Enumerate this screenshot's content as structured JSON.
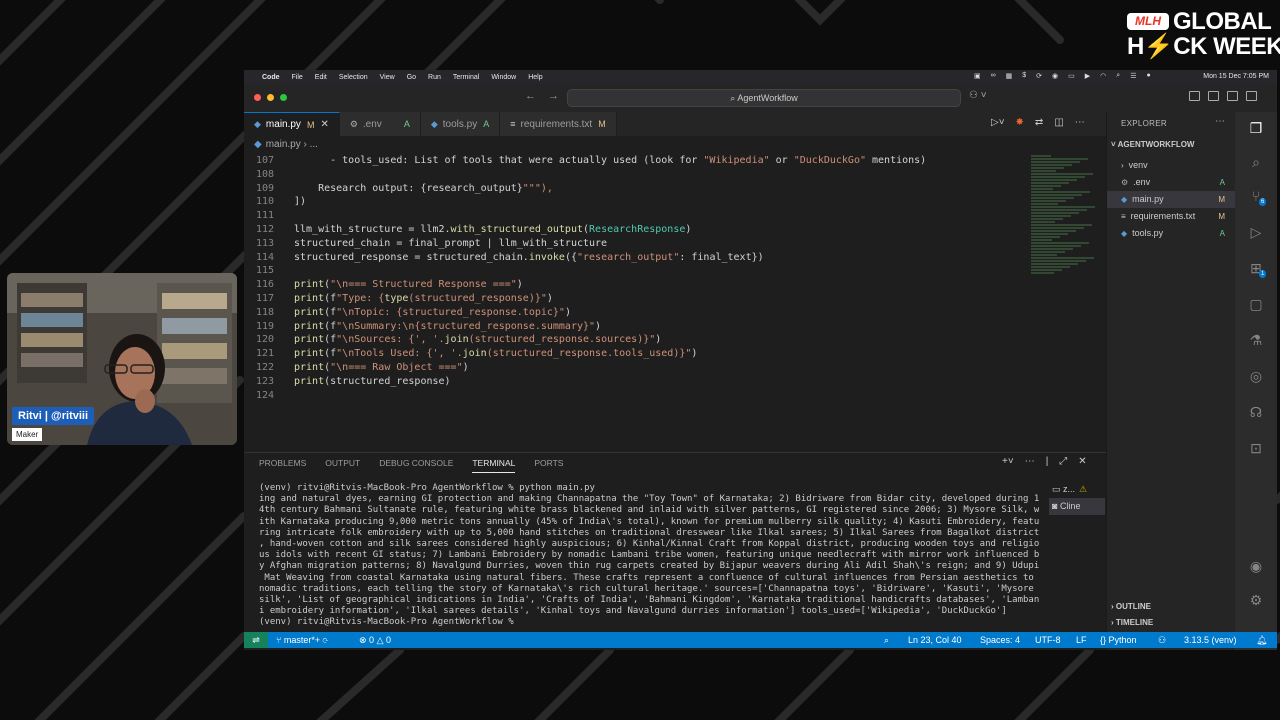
{
  "branding": {
    "badge": "MLH",
    "line1": "GLOBAL",
    "line2a": "H",
    "line2b": "CK WEEK"
  },
  "webcam": {
    "name": "Ritvi | @ritviii",
    "role": "Maker"
  },
  "menubar": {
    "items": [
      "Code",
      "File",
      "Edit",
      "Selection",
      "View",
      "Go",
      "Run",
      "Terminal",
      "Window",
      "Help"
    ],
    "datetime": "Mon 15 Dec  7:05 PM"
  },
  "titlebar": {
    "search": "AgentWorkflow"
  },
  "tabs": [
    {
      "label": "main.py",
      "status": "M",
      "active": true
    },
    {
      "label": ".env",
      "status": "A",
      "active": false
    },
    {
      "label": "tools.py",
      "status": "A",
      "active": false
    },
    {
      "label": "requirements.txt",
      "status": "M",
      "active": false
    }
  ],
  "breadcrumb": {
    "file": "main.py",
    "rest": "..."
  },
  "editor": {
    "lines": [
      {
        "n": "107",
        "t": "      - tools_used: List of tools that were actually used (look for \"Wikipedia\" or \"DuckDuckGo\" mentions)"
      },
      {
        "n": "108",
        "t": ""
      },
      {
        "n": "109",
        "t": "    Research output: {research_output}\"\"\"),"
      },
      {
        "n": "110",
        "t": "])"
      },
      {
        "n": "111",
        "t": ""
      },
      {
        "n": "112",
        "t": "llm_with_structure = llm2.with_structured_output(ResearchResponse)"
      },
      {
        "n": "113",
        "t": "structured_chain = final_prompt | llm_with_structure"
      },
      {
        "n": "114",
        "t": "structured_response = structured_chain.invoke({\"research_output\": final_text})"
      },
      {
        "n": "115",
        "t": ""
      },
      {
        "n": "116",
        "t": "print(\"\\n=== Structured Response ===\")"
      },
      {
        "n": "117",
        "t": "print(f\"Type: {type(structured_response)}\")"
      },
      {
        "n": "118",
        "t": "print(f\"\\nTopic: {structured_response.topic}\")"
      },
      {
        "n": "119",
        "t": "print(f\"\\nSummary:\\n{structured_response.summary}\")"
      },
      {
        "n": "120",
        "t": "print(f\"\\nSources: {', '.join(structured_response.sources)}\")"
      },
      {
        "n": "121",
        "t": "print(f\"\\nTools Used: {', '.join(structured_response.tools_used)}\")"
      },
      {
        "n": "122",
        "t": "print(\"\\n=== Raw Object ===\")"
      },
      {
        "n": "123",
        "t": "print(structured_response)"
      },
      {
        "n": "124",
        "t": ""
      }
    ]
  },
  "panel": {
    "tabs": [
      "PROBLEMS",
      "OUTPUT",
      "DEBUG CONSOLE",
      "TERMINAL",
      "PORTS"
    ],
    "active_tab": "TERMINAL",
    "terminal_lines": [
      "(venv) ritvi@Ritvis-MacBook-Pro AgentWorkflow % python main.py",
      "ing and natural dyes, earning GI protection and making Channapatna the \"Toy Town\" of Karnataka; 2) Bidriware from Bidar city, developed during 1",
      "4th century Bahmani Sultanate rule, featuring white brass blackened and inlaid with silver patterns, GI registered since 2006; 3) Mysore Silk, w",
      "ith Karnataka producing 9,000 metric tons annually (45% of India\\'s total), known for premium mulberry silk quality; 4) Kasuti Embroidery, featu",
      "ring intricate folk embroidery with up to 5,000 hand stitches on traditional dresswear like Ilkal sarees; 5) Ilkal Sarees from Bagalkot district",
      ", hand-woven cotton and silk sarees considered highly auspicious; 6) Kinhal/Kinnal Craft from Koppal district, producing wooden toys and religio",
      "us idols with recent GI status; 7) Lambani Embroidery by nomadic Lambani tribe women, featuring unique needlecraft with mirror work influenced b",
      "y Afghan migration patterns; 8) Navalgund Durries, woven thin rug carpets created by Bijapur weavers during Ali Adil Shah\\'s reign; and 9) Udupi",
      " Mat Weaving from coastal Karnataka using natural fibers. These crafts represent a confluence of cultural influences from Persian aesthetics to",
      "nomadic traditions, each telling the story of Karnataka\\'s rich cultural heritage.' sources=['Channapatna toys', 'Bidriware', 'Kasuti', 'Mysore",
      "silk', 'List of geographical indications in India', 'Crafts of India', 'Bahmani Kingdom', 'Karnataka traditional handicrafts databases', 'Lamban",
      "i embroidery information', 'Ilkal sarees details', 'Kinhal toys and Navalgund durries information'] tools_used=['Wikipedia', 'DuckDuckGo']",
      "(venv) ritvi@Ritvis-MacBook-Pro AgentWorkflow % "
    ],
    "side_items": [
      "z...",
      "Cline"
    ]
  },
  "explorer": {
    "title": "EXPLORER",
    "section": "AGENTWORKFLOW",
    "items": [
      {
        "label": "venv",
        "status": "",
        "kind": "folder"
      },
      {
        "label": ".env",
        "status": "A",
        "kind": "env"
      },
      {
        "label": "main.py",
        "status": "M",
        "kind": "py"
      },
      {
        "label": "requirements.txt",
        "status": "M",
        "kind": "txt"
      },
      {
        "label": "tools.py",
        "status": "A",
        "kind": "py"
      }
    ],
    "outline": "OUTLINE",
    "timeline": "TIMELINE"
  },
  "statusbar": {
    "branch": "master*+",
    "errors": "0",
    "warnings": "0",
    "position": "Ln 23, Col 40",
    "spaces": "Spaces: 4",
    "encoding": "UTF-8",
    "eol": "LF",
    "language": "Python",
    "interpreter": "3.13.5 (venv)"
  }
}
